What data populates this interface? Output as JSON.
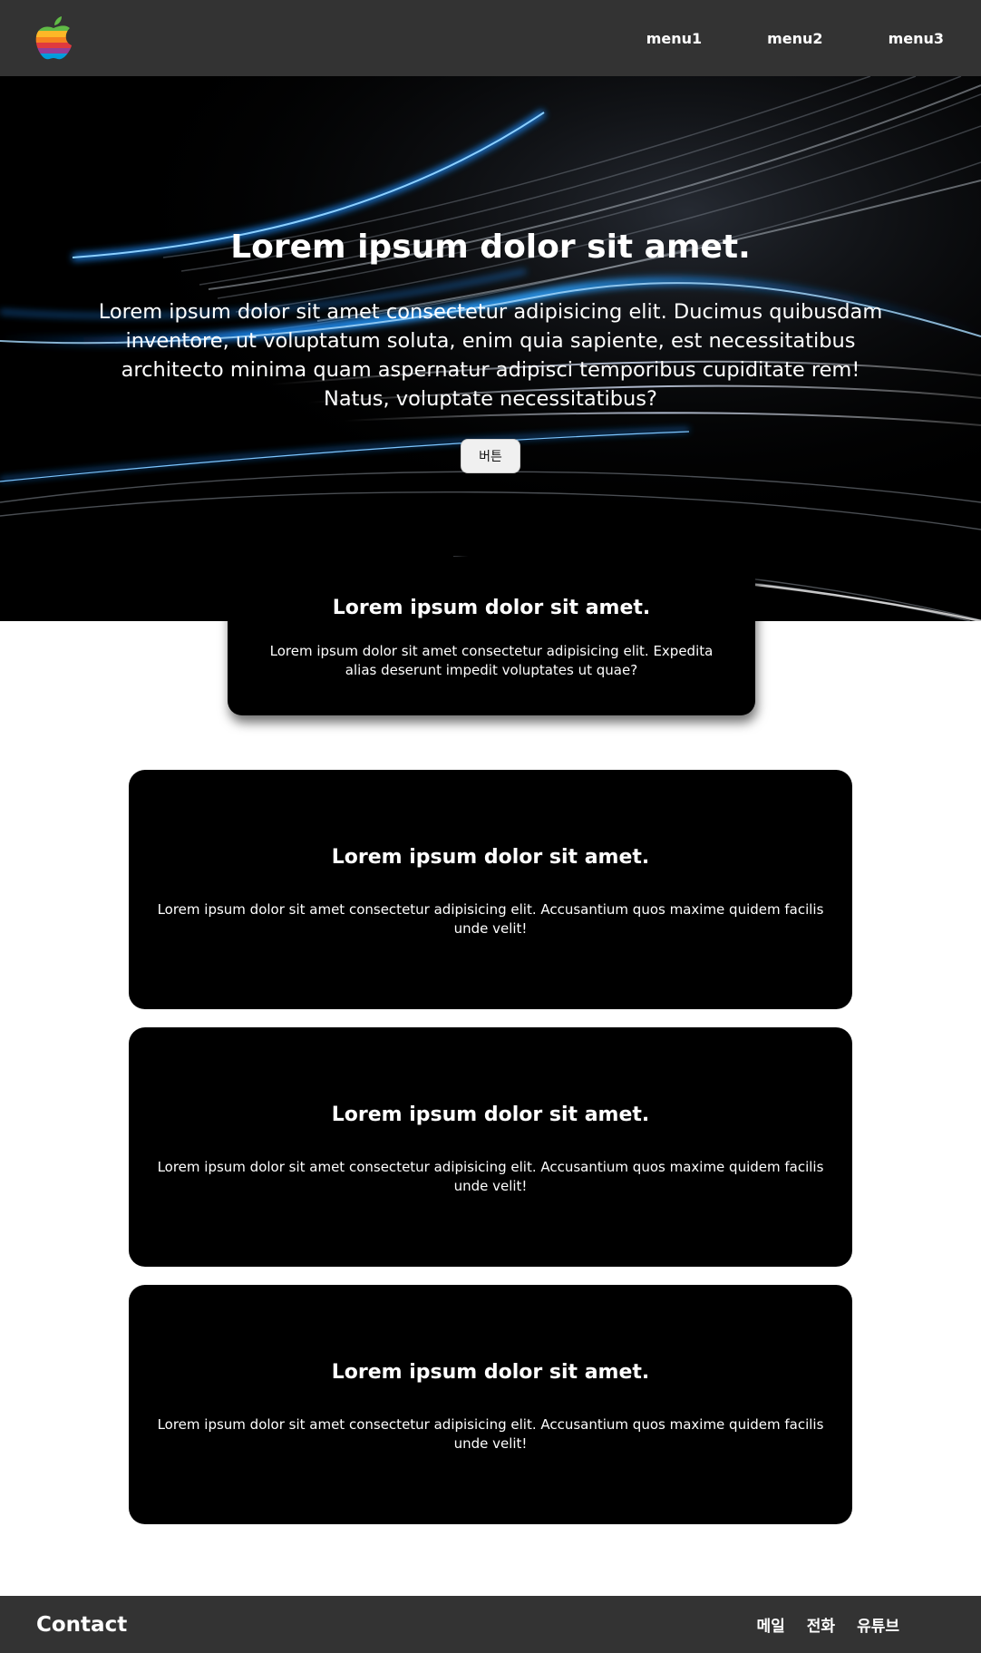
{
  "header": {
    "logo_name": "apple-logo",
    "menu": [
      "menu1",
      "menu2",
      "menu3"
    ]
  },
  "hero": {
    "title": "Lorem ipsum dolor sit amet.",
    "text": "Lorem ipsum dolor sit amet consectetur adipisicing elit. Ducimus quibusdam inventore, ut voluptatum soluta, enim quia sapiente, est necessitatibus architecto minima quam aspernatur adipisci temporibus cupiditate rem! Natus, voluptate necessitatibus?",
    "button_label": "버튼"
  },
  "featured_card": {
    "title": "Lorem ipsum dolor sit amet.",
    "text": "Lorem ipsum dolor sit amet consectetur adipisicing elit. Expedita alias deserunt impedit voluptates ut quae?"
  },
  "cards": [
    {
      "title": "Lorem ipsum dolor sit amet.",
      "text": "Lorem ipsum dolor sit amet consectetur adipisicing elit. Accusantium quos maxime quidem facilis unde velit!"
    },
    {
      "title": "Lorem ipsum dolor sit amet.",
      "text": "Lorem ipsum dolor sit amet consectetur adipisicing elit. Accusantium quos maxime quidem facilis unde velit!"
    },
    {
      "title": "Lorem ipsum dolor sit amet.",
      "text": "Lorem ipsum dolor sit amet consectetur adipisicing elit. Accusantium quos maxime quidem facilis unde velit!"
    }
  ],
  "footer": {
    "title": "Contact",
    "links": [
      "메일",
      "전화",
      "유튜브"
    ]
  },
  "colors": {
    "header_bg": "#333333",
    "card_bg": "#000000",
    "accent_blue": "#1e8fff"
  }
}
